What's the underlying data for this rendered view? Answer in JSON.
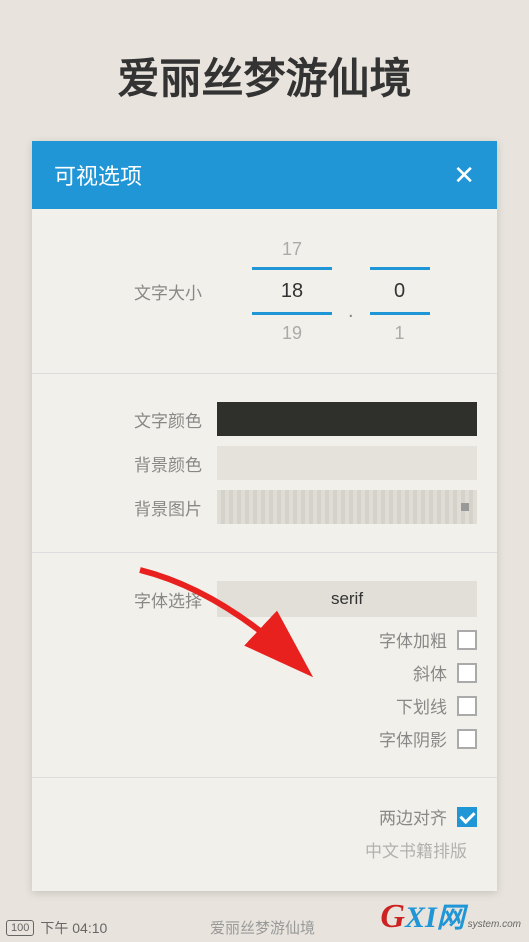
{
  "pageTitle": "爱丽丝梦游仙境",
  "dialog": {
    "title": "可视选项",
    "fontSize": {
      "label": "文字大小",
      "intPrev": "17",
      "intCur": "18",
      "intNext": "19",
      "dot": ".",
      "decPrev": "",
      "decCur": "0",
      "decNext": "1"
    },
    "colors": {
      "textColorLabel": "文字颜色",
      "textColorValue": "#2f2f2b",
      "bgColorLabel": "背景颜色",
      "bgColorValue": "#e5e2dc",
      "bgImageLabel": "背景图片"
    },
    "font": {
      "label": "字体选择",
      "value": "serif",
      "bold": "字体加粗",
      "italic": "斜体",
      "underline": "下划线",
      "shadow": "字体阴影"
    },
    "justify": {
      "label": "两边对齐",
      "checked": true
    },
    "cjk": "中文书籍排版"
  },
  "statusbar": {
    "battery": "100",
    "time": "下午 04:10",
    "title": "爱丽丝梦游仙境"
  },
  "watermark": {
    "g": "G",
    "xi": "XI",
    "net": "网",
    "sub": "system.com"
  }
}
